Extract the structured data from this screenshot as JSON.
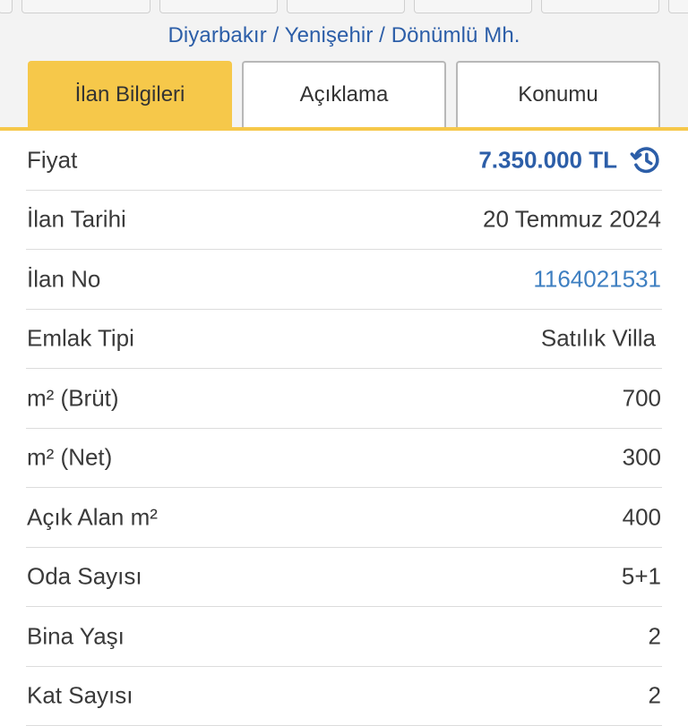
{
  "breadcrumb": {
    "text": "Diyarbakır / Yenişehir / Dönümlü Mh."
  },
  "tabs": [
    {
      "label": "İlan Bilgileri",
      "active": true
    },
    {
      "label": "Açıklama",
      "active": false
    },
    {
      "label": "Konumu",
      "active": false
    }
  ],
  "colors": {
    "accent": "#f6c84a",
    "link": "#2c5ea8",
    "price": "#2c5ea8"
  },
  "details": {
    "price": {
      "label": "Fiyat",
      "value": "7.350.000 TL",
      "icon": "price-history-icon"
    },
    "listing_date": {
      "label": "İlan Tarihi",
      "value": "20 Temmuz 2024"
    },
    "listing_no": {
      "label": "İlan No",
      "value": "1164021531"
    },
    "property_type": {
      "label": "Emlak Tipi",
      "value": "Satılık Villa"
    },
    "gross_area": {
      "label": "m² (Brüt)",
      "value": "700"
    },
    "net_area": {
      "label": "m² (Net)",
      "value": "300"
    },
    "open_area": {
      "label": "Açık Alan m²",
      "value": "400"
    },
    "room_count": {
      "label": "Oda Sayısı",
      "value": "5+1"
    },
    "building_age": {
      "label": "Bina Yaşı",
      "value": "2"
    },
    "floor_count": {
      "label": "Kat Sayısı",
      "value": "2"
    }
  }
}
